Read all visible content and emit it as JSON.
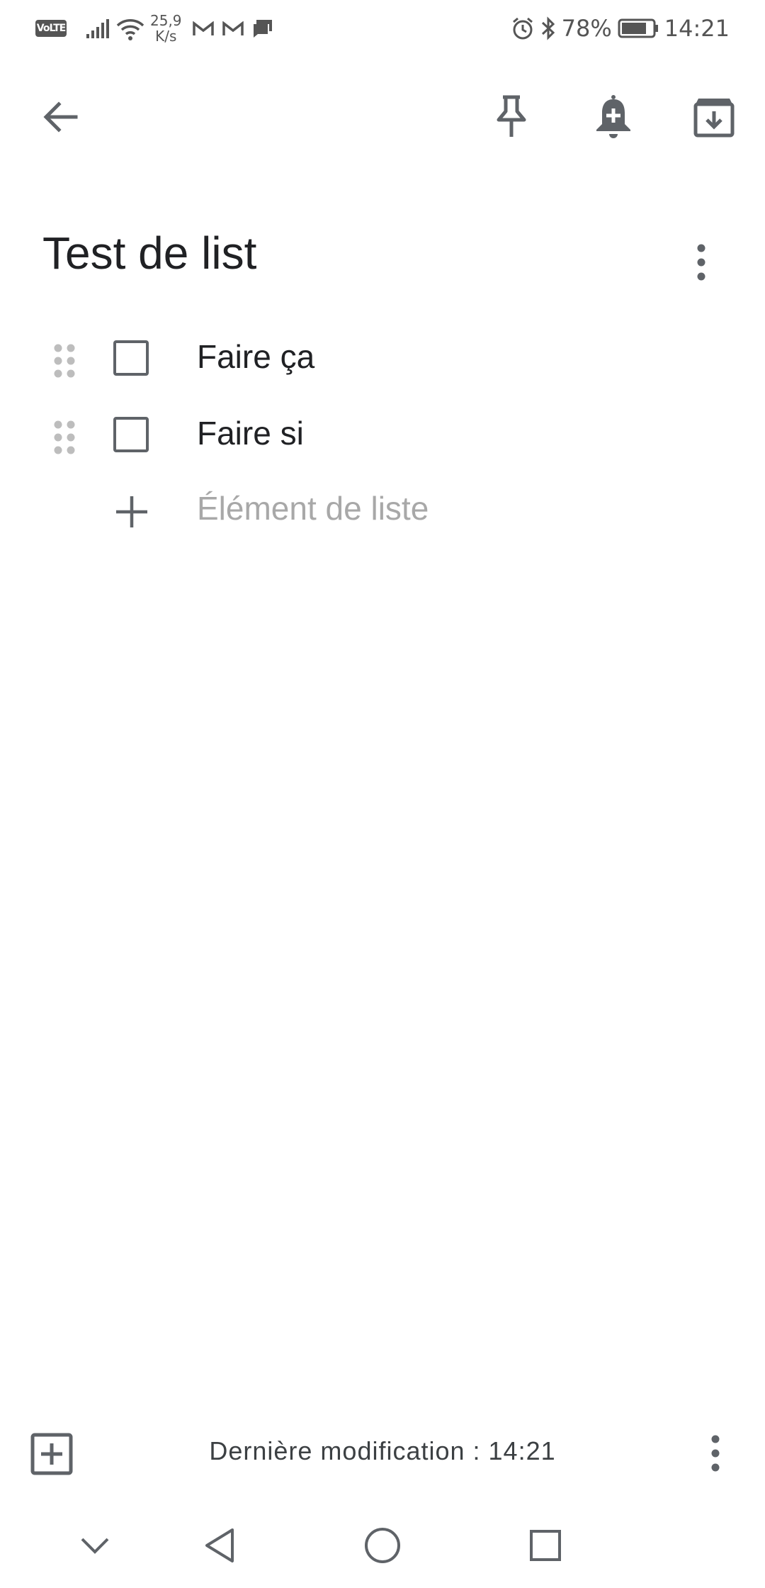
{
  "status_bar": {
    "volte": "VoLTE",
    "speed_value": "25,9",
    "speed_unit": "K/s",
    "battery_percent": "78%",
    "time": "14:21",
    "icons": [
      "volte-icon",
      "signal-icon",
      "wifi-icon",
      "gmail-icon",
      "gmail-icon",
      "message-icon",
      "alarm-icon",
      "bluetooth-icon",
      "battery-icon"
    ]
  },
  "toolbar": {
    "icons": [
      "back-arrow-icon",
      "pin-icon",
      "reminder-bell-icon",
      "archive-icon"
    ]
  },
  "note": {
    "title": "Test de list",
    "items": [
      {
        "text": "Faire ça",
        "checked": false
      },
      {
        "text": "Faire si",
        "checked": false
      }
    ],
    "add_item_placeholder": "Élément de liste"
  },
  "bottom_bar": {
    "last_modified": "Dernière modification : 14:21"
  },
  "colors": {
    "icon": "#5f6368",
    "text": "#202124",
    "placeholder": "#a8a8a8",
    "background": "#ffffff"
  }
}
